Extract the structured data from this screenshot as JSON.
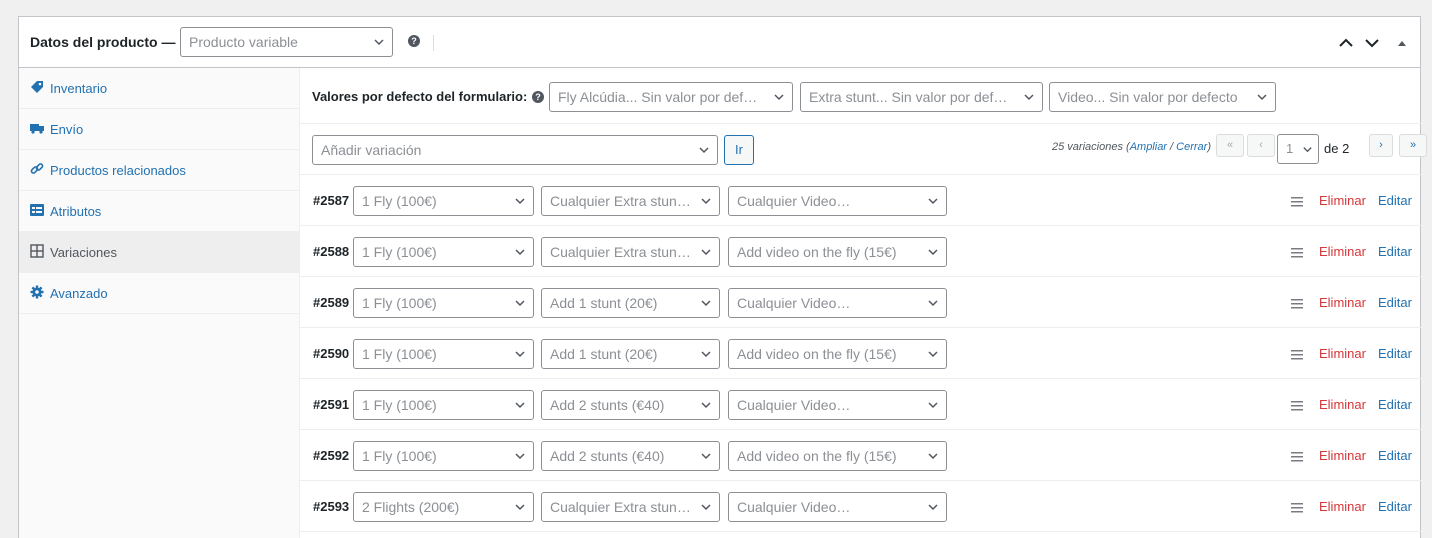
{
  "header": {
    "title": "Datos del producto —",
    "product_type": "Producto variable"
  },
  "sidebar": {
    "items": [
      {
        "label": "Inventario",
        "icon": "tag-icon"
      },
      {
        "label": "Envío",
        "icon": "truck-icon"
      },
      {
        "label": "Productos relacionados",
        "icon": "link-icon"
      },
      {
        "label": "Atributos",
        "icon": "list-icon"
      },
      {
        "label": "Variaciones",
        "icon": "grid-icon",
        "active": true
      },
      {
        "label": "Avanzado",
        "icon": "gear-icon"
      }
    ]
  },
  "defaults": {
    "label": "Valores por defecto del formulario:",
    "selects": [
      "Fly Alcúdia... Sin valor por defecto",
      "Extra stunt... Sin valor por defecto",
      "Video... Sin valor por defecto"
    ]
  },
  "toolbar": {
    "add_variation": "Añadir variación",
    "go_label": "Ir",
    "count_text": "25 variaciones",
    "expand_label": "Ampliar",
    "sep": " / ",
    "close_label": "Cerrar",
    "open_paren": "(",
    "close_paren": ")",
    "first": "«",
    "prev": "‹",
    "page": "1",
    "of_label": "de 2",
    "next": "›",
    "last": "»"
  },
  "variations": [
    {
      "id": "#2587",
      "fly": "1 Fly (100€)",
      "stunt": "Cualquier Extra stunt…",
      "video": "Cualquier Video…"
    },
    {
      "id": "#2588",
      "fly": "1 Fly (100€)",
      "stunt": "Cualquier Extra stunt…",
      "video": "Add video on the fly (15€)"
    },
    {
      "id": "#2589",
      "fly": "1 Fly (100€)",
      "stunt": "Add 1 stunt (20€)",
      "video": "Cualquier Video…"
    },
    {
      "id": "#2590",
      "fly": "1 Fly (100€)",
      "stunt": "Add 1 stunt (20€)",
      "video": "Add video on the fly (15€)"
    },
    {
      "id": "#2591",
      "fly": "1 Fly (100€)",
      "stunt": "Add 2 stunts (€40)",
      "video": "Cualquier Video…"
    },
    {
      "id": "#2592",
      "fly": "1 Fly (100€)",
      "stunt": "Add 2 stunts (€40)",
      "video": "Add video on the fly (15€)"
    },
    {
      "id": "#2593",
      "fly": "2 Flights (200€)",
      "stunt": "Cualquier Extra stunt…",
      "video": "Cualquier Video…"
    }
  ],
  "row_actions": {
    "delete": "Eliminar",
    "edit": "Editar"
  },
  "colors": {
    "link": "#2271b1",
    "danger": "#d63638",
    "border": "#c3c4c7"
  }
}
